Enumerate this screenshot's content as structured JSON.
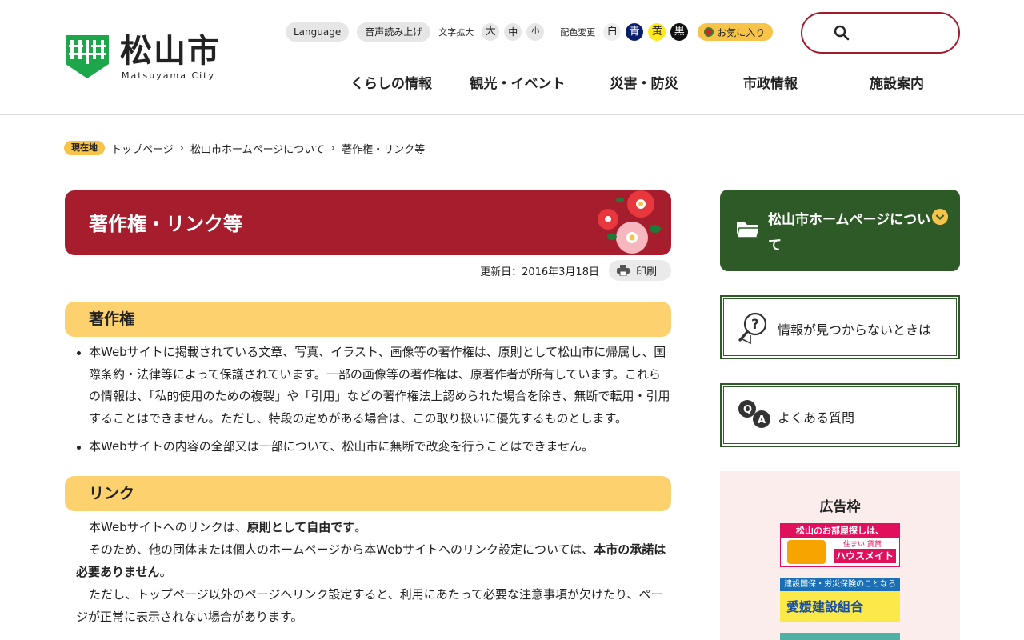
{
  "site": {
    "name": "松山市",
    "sub": "Matsuyama City"
  },
  "util": {
    "language": "Language",
    "voice": "音声読み上げ",
    "text_size_label": "文字拡大",
    "sizes": [
      "大",
      "中",
      "小"
    ],
    "color_label": "配色変更",
    "colors": [
      "白",
      "青",
      "黄",
      "黒"
    ],
    "favorites": "お気に入り"
  },
  "search": {
    "placeholder": ""
  },
  "gnav": [
    "くらしの情報",
    "観光・イベント",
    "災害・防災",
    "市政情報",
    "施設案内"
  ],
  "breadcrumb": {
    "badge": "現在地",
    "items": [
      "トップページ",
      "松山市ホームページについて"
    ],
    "current": "著作権・リンク等"
  },
  "page": {
    "title": "著作権・リンク等",
    "updated": "更新日：2016年3月18日",
    "print": "印刷"
  },
  "section1": {
    "heading": "著作権",
    "items": [
      "本Webサイトに掲載されている文章、写真、イラスト、画像等の著作権は、原則として松山市に帰属し、国際条約・法律等によって保護されています。一部の画像等の著作権は、原著作者が所有しています。これらの情報は、「私的使用のための複製」や「引用」などの著作権法上認められた場合を除き、無断で転用・引用することはできません。ただし、特段の定めがある場合は、この取り扱いに優先するものとします。",
      "本Webサイトの内容の全部又は一部について、松山市に無断で改変を行うことはできません。"
    ]
  },
  "section2": {
    "heading": "リンク",
    "p1_pre": "本Webサイトへのリンクは、",
    "p1_bold": "原則として自由です",
    "p1_post": "。",
    "p2_pre": "そのため、他の団体または個人のホームページから本Webサイトへのリンク設定については、",
    "p2_bold": "本市の承諾は必要ありません",
    "p2_post": "。",
    "p3": "ただし、トップページ以外のページへリンク設定すると、利用にあたって必要な注意事項が欠けたり、ページが正常に表示されない場合があります。"
  },
  "sidebar": {
    "category": "松山市ホームページについて",
    "notfound": "情報が見つからないときは",
    "faq": "よくある質問",
    "ad_title": "広告枠",
    "ad1_top": "松山のお部屋探しは、",
    "ad1_small": "住まい 賃貸",
    "ad1_brand": "ハウスメイト",
    "ad2_top": "建設国保・労災保険のことなら",
    "ad2_main": "愛媛建設組合"
  },
  "colors": {
    "brand_red": "#a61e2d",
    "section_yellow": "#fdd16e",
    "sidebar_green": "#2d5a27"
  }
}
